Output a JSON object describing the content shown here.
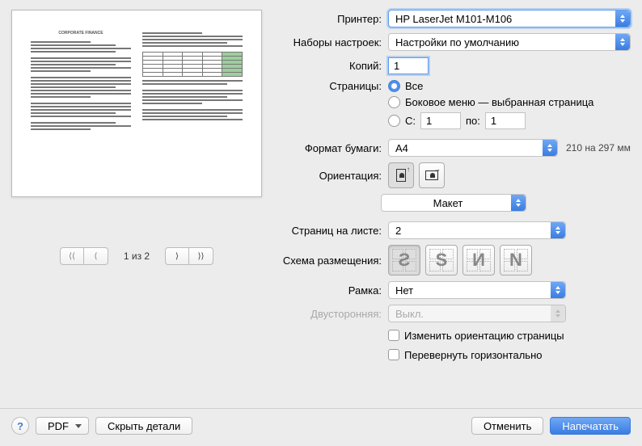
{
  "labels": {
    "printer": "Принтер:",
    "presets": "Наборы настроек:",
    "copies": "Копий:",
    "pages": "Страницы:",
    "paper_size": "Формат бумаги:",
    "orientation": "Ориентация:",
    "pages_per_sheet": "Страниц на листе:",
    "layout_direction": "Схема размещения:",
    "border": "Рамка:",
    "two_sided": "Двусторонняя:"
  },
  "printer": {
    "value": "HP LaserJet M101-M106"
  },
  "presets": {
    "value": "Настройки по умолчанию"
  },
  "copies": {
    "value": "1"
  },
  "pages_radio": {
    "all": "Все",
    "side_menu": "Боковое меню — выбранная страница",
    "from_label": "С:",
    "to_label": "по:",
    "from_value": "1",
    "to_value": "1"
  },
  "paper": {
    "value": "A4",
    "hint": "210 на 297 мм"
  },
  "section_dropdown": {
    "value": "Макет"
  },
  "pages_per_sheet": {
    "value": "2"
  },
  "border": {
    "value": "Нет"
  },
  "two_sided": {
    "value": "Выкл."
  },
  "checkboxes": {
    "change_orientation": "Изменить ориентацию страницы",
    "flip_horizontal": "Перевернуть горизонтально"
  },
  "footer": {
    "pdf": "PDF",
    "hide_details": "Скрыть детали",
    "cancel": "Отменить",
    "print": "Напечатать"
  },
  "pager": {
    "text": "1 из 2"
  }
}
